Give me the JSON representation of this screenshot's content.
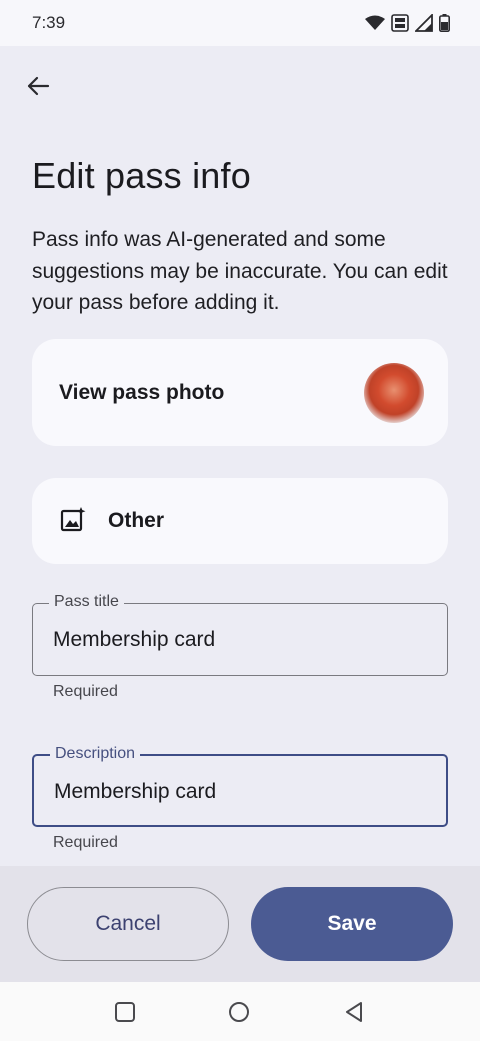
{
  "status_bar": {
    "time": "7:39",
    "icons": [
      "wifi-icon",
      "volte-icon",
      "signal-icon",
      "battery-icon"
    ]
  },
  "header": {
    "back_icon": "arrow-back-icon",
    "title": "Edit pass info",
    "description": "Pass info was AI-generated and some suggestions may be inaccurate. You can edit your pass before adding it."
  },
  "pass_photo": {
    "label": "View pass photo"
  },
  "pass_type": {
    "icon": "image-sparkle-icon",
    "label": "Other"
  },
  "fields": {
    "title": {
      "label": "Pass title",
      "value": "Membership card",
      "helper": "Required"
    },
    "description": {
      "label": "Description",
      "value": "Membership card",
      "helper": "Required"
    }
  },
  "actions": {
    "cancel_label": "Cancel",
    "save_label": "Save"
  },
  "colors": {
    "background": "#ececf4",
    "primary": "#4b5b93",
    "card": "#f9f9fd"
  },
  "nav": {
    "icons": [
      "recents-square-icon",
      "home-circle-icon",
      "back-triangle-icon"
    ]
  }
}
